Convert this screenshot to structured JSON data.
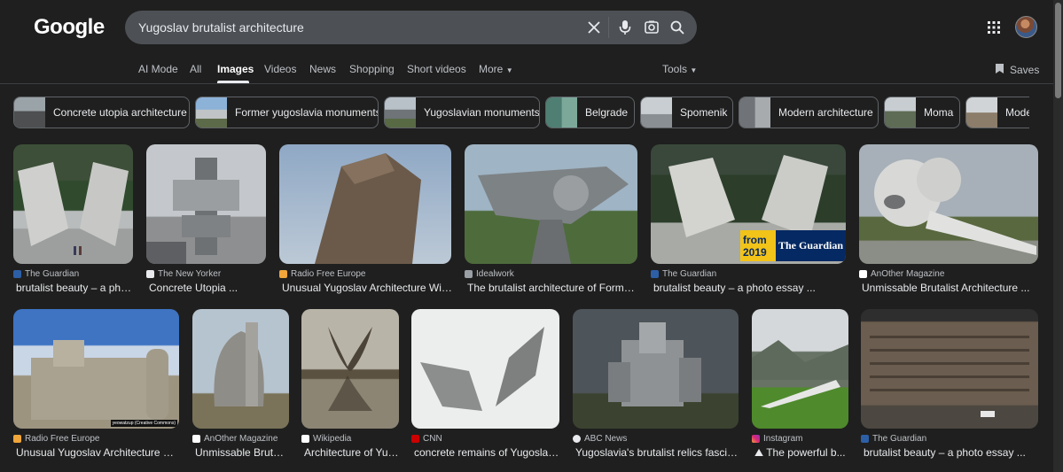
{
  "logo": "Google",
  "search": {
    "query": "Yugoslav brutalist architecture"
  },
  "tabs": [
    {
      "label": "AI Mode"
    },
    {
      "label": "All"
    },
    {
      "label": "Images",
      "active": true
    },
    {
      "label": "Videos"
    },
    {
      "label": "News"
    },
    {
      "label": "Shopping"
    },
    {
      "label": "Short videos"
    },
    {
      "label": "More"
    }
  ],
  "tools_label": "Tools",
  "saves_label": "Saves",
  "chips": [
    {
      "label": "Concrete utopia architecture"
    },
    {
      "label": "Former yugoslavia monuments"
    },
    {
      "label": "Yugoslavian monuments"
    },
    {
      "label": "Belgrade"
    },
    {
      "label": "Spomenik"
    },
    {
      "label": "Modern architecture"
    },
    {
      "label": "Moma"
    },
    {
      "label": "Mode"
    }
  ],
  "results_row1": [
    {
      "source": "The Guardian",
      "title": "brutalist beauty – a phot..."
    },
    {
      "source": "The New Yorker",
      "title": "Concrete Utopia ..."
    },
    {
      "source": "Radio Free Europe",
      "title": "Unusual Yugoslav Architecture Wins ..."
    },
    {
      "source": "Idealwork",
      "title": "The brutalist architecture of Former ..."
    },
    {
      "source": "The Guardian",
      "title": "brutalist beauty – a photo essay ...",
      "badge_year": "from 2019",
      "badge_brand": "The Guardian"
    },
    {
      "source": "AnOther Magazine",
      "title": "Unmissable Brutalist Architecture ..."
    }
  ],
  "results_row2": [
    {
      "source": "Radio Free Europe",
      "title": "Unusual Yugoslav Architecture Win...",
      "credit": "yeowatzup (Creative Commons)"
    },
    {
      "source": "AnOther Magazine",
      "title": "Unmissable Brutali..."
    },
    {
      "source": "Wikipedia",
      "title": "Architecture of Yug..."
    },
    {
      "source": "CNN",
      "title": "concrete remains of Yugoslav ..."
    },
    {
      "source": "ABC News",
      "title": "Yugoslavia's brutalist relics fascinat..."
    },
    {
      "source": "Instagram",
      "title": "⛰ The powerful b..."
    },
    {
      "source": "The Guardian",
      "title": "brutalist beauty – a photo essay ..."
    }
  ]
}
